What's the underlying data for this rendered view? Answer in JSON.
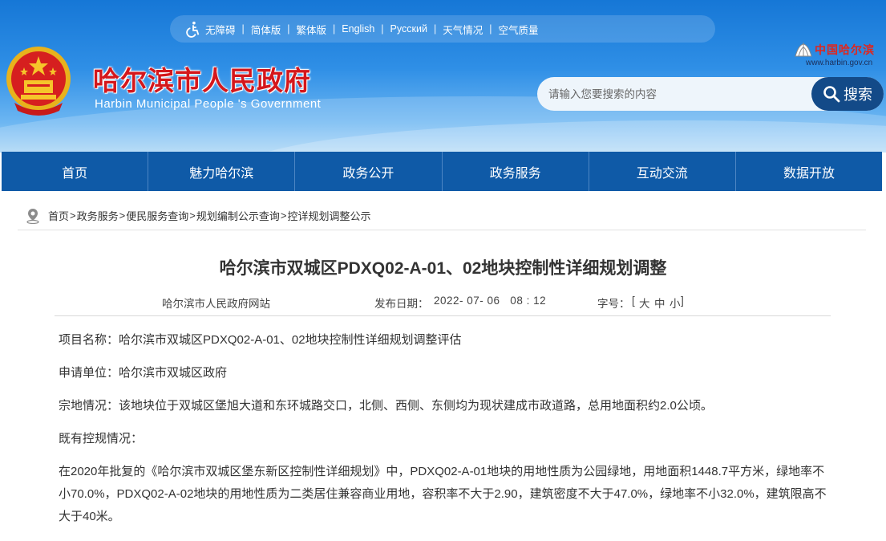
{
  "topbar": {
    "links": [
      "无障碍",
      "简体版",
      "繁体版",
      "English",
      "Русский",
      "天气情况",
      "空气质量"
    ]
  },
  "header": {
    "title": "哈尔滨市人民政府",
    "subtitle": "Harbin Municipal People 's Government",
    "brand_cn": "中国哈尔滨",
    "brand_url": "www.harbin.gov.cn"
  },
  "search": {
    "placeholder": "请输入您要搜索的内容",
    "button_label": "搜索"
  },
  "nav": {
    "items": [
      "首页",
      "魅力哈尔滨",
      "政务公开",
      "政务服务",
      "互动交流",
      "数据开放"
    ]
  },
  "breadcrumb": {
    "items": [
      "首页",
      "政务服务",
      "便民服务查询",
      "规划编制公示查询",
      "控详规划调整公示"
    ],
    "separator": ">"
  },
  "article": {
    "title": "哈尔滨市双城区PDXQ02-A-01、02地块控制性详细规划调整",
    "source": "哈尔滨市人民政府网站",
    "date_label": "发布日期：",
    "date_value": "2022- 07- 06   08 : 12",
    "font_size_label": "字号：",
    "font_size_open": "[",
    "font_size_options": [
      "大",
      "中",
      "小"
    ],
    "font_size_close": "]",
    "paragraphs": [
      "项目名称：哈尔滨市双城区PDXQ02-A-01、02地块控制性详细规划调整评估",
      "申请单位：哈尔滨市双城区政府",
      "宗地情况：该地块位于双城区堡旭大道和东环城路交口，北侧、西侧、东侧均为现状建成市政道路，总用地面积约2.0公顷。",
      "既有控规情况：",
      "在2020年批复的《哈尔滨市双城区堡东新区控制性详细规划》中，PDXQ02-A-01地块的用地性质为公园绿地，用地面积1448.7平方米，绿地率不小70.0%，PDXQ02-A-02地块的用地性质为二类居住兼容商业用地，容积率不大于2.90，建筑密度不大于47.0%，绿地率不小32.0%，建筑限高不大于40米。"
    ]
  },
  "colors": {
    "header_blue": "#1677d6",
    "nav_blue": "#0f5aa7",
    "search_button": "#134a88",
    "title_red": "#d4171c"
  },
  "icons": [
    "accessibility-icon",
    "national-emblem-icon",
    "harbin-logo-icon",
    "search-icon",
    "location-pin-icon"
  ]
}
